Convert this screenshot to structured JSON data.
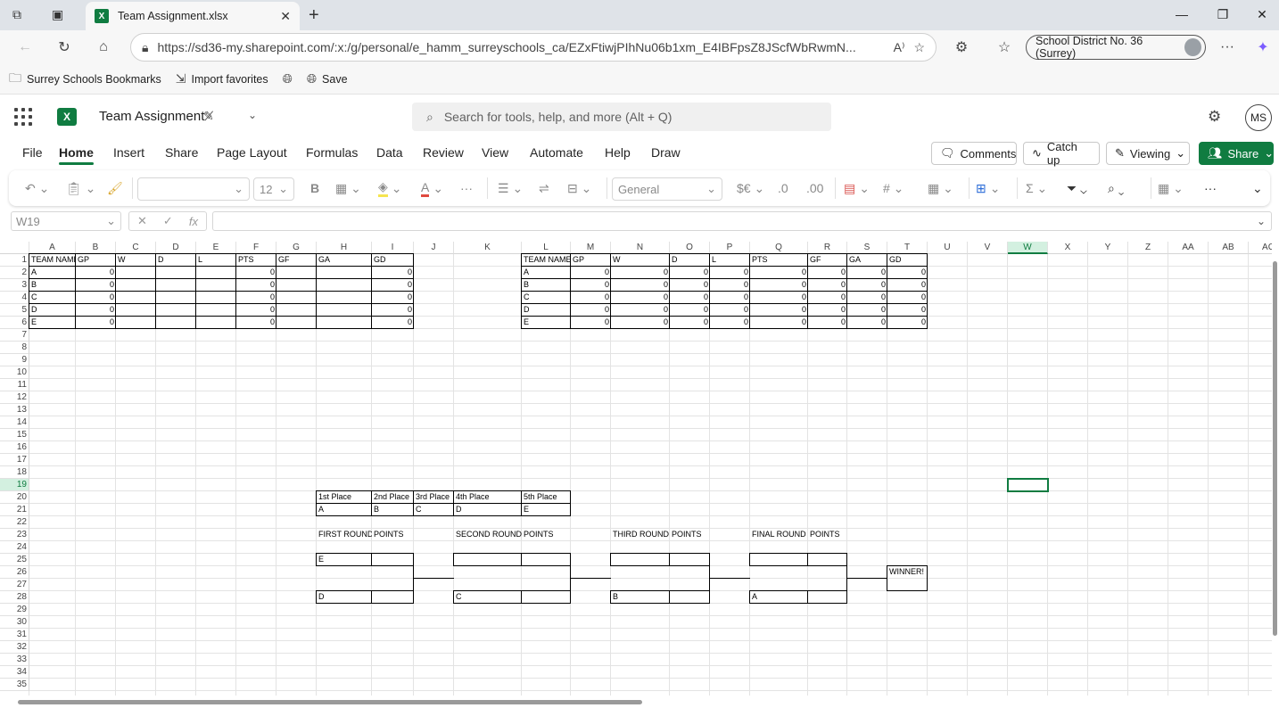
{
  "browser": {
    "tab_title": "Team Assignment.xlsx",
    "url": "https://sd36-my.sharepoint.com/:x:/g/personal/e_hamm_surreyschools_ca/EZxFtiwjPIhNu06b1xm_E4IBFpsZ8JScfWbRwmN...",
    "profile_name": "School District No. 36 (Surrey)",
    "favorites": [
      "Surrey Schools Bookmarks",
      "Import favorites",
      "Save"
    ]
  },
  "app": {
    "title": "Team Assignment",
    "search_placeholder": "Search for tools, help, and more (Alt + Q)",
    "user_initials": "MS",
    "menu_tabs": [
      "File",
      "Home",
      "Insert",
      "Share",
      "Page Layout",
      "Formulas",
      "Data",
      "Review",
      "View",
      "Automate",
      "Help",
      "Draw"
    ],
    "active_tab": "Home",
    "buttons": {
      "comments": "Comments",
      "catch_up": "Catch up",
      "viewing": "Viewing",
      "share": "Share"
    }
  },
  "ribbon": {
    "font_size": "12",
    "number_format": "General"
  },
  "formula_bar": {
    "name_box": "W19",
    "formula": ""
  },
  "sheet": {
    "columns": [
      "A",
      "B",
      "C",
      "D",
      "E",
      "F",
      "G",
      "H",
      "I",
      "J",
      "K",
      "L",
      "M",
      "N",
      "O",
      "P",
      "Q",
      "R",
      "S",
      "T",
      "U",
      "V",
      "W",
      "X",
      "Y",
      "Z",
      "AA",
      "AB",
      "AC"
    ],
    "selected_column": "W",
    "selected_row": 19,
    "rows": [
      1,
      2,
      3,
      4,
      5,
      6,
      7,
      8,
      9,
      10,
      11,
      12,
      13,
      14,
      15,
      16,
      17,
      18,
      19,
      20,
      21,
      22,
      23,
      24,
      25,
      26,
      27,
      28,
      29,
      30,
      31,
      32,
      33,
      34,
      35
    ],
    "left_table": {
      "headers": [
        "TEAM NAME",
        "GP",
        "W",
        "D",
        "L",
        "PTS",
        "GF",
        "GA",
        "GD"
      ],
      "rows": [
        [
          "A",
          "0",
          "",
          "",
          "",
          "0",
          "",
          "",
          "0"
        ],
        [
          "B",
          "0",
          "",
          "",
          "",
          "0",
          "",
          "",
          "0"
        ],
        [
          "C",
          "0",
          "",
          "",
          "",
          "0",
          "",
          "",
          "0"
        ],
        [
          "D",
          "0",
          "",
          "",
          "",
          "0",
          "",
          "",
          "0"
        ],
        [
          "E",
          "0",
          "",
          "",
          "",
          "0",
          "",
          "",
          "0"
        ]
      ]
    },
    "right_table": {
      "headers": [
        "TEAM NAME",
        "GP",
        "W",
        "D",
        "L",
        "PTS",
        "GF",
        "GA",
        "GD"
      ],
      "rows": [
        [
          "A",
          "0",
          "0",
          "0",
          "0",
          "0",
          "0",
          "0",
          "0"
        ],
        [
          "B",
          "0",
          "0",
          "0",
          "0",
          "0",
          "0",
          "0",
          "0"
        ],
        [
          "C",
          "0",
          "0",
          "0",
          "0",
          "0",
          "0",
          "0",
          "0"
        ],
        [
          "D",
          "0",
          "0",
          "0",
          "0",
          "0",
          "0",
          "0",
          "0"
        ],
        [
          "E",
          "0",
          "0",
          "0",
          "0",
          "0",
          "0",
          "0",
          "0"
        ]
      ]
    },
    "places": {
      "headers": [
        "1st Place",
        "2nd Place",
        "3rd Place",
        "4th Place",
        "5th Place"
      ],
      "values": [
        "A",
        "B",
        "C",
        "D",
        "E"
      ]
    },
    "bracket": {
      "round_labels": [
        "FIRST ROUND",
        "SECOND ROUND",
        "THIRD ROUND",
        "FINAL ROUND"
      ],
      "points_label": "POINTS",
      "first_round": [
        "E",
        "D"
      ],
      "second_round": [
        "",
        "C"
      ],
      "third_round": [
        "",
        "B"
      ],
      "final_round": [
        "",
        "A"
      ],
      "winner_label": "WINNER!"
    }
  }
}
